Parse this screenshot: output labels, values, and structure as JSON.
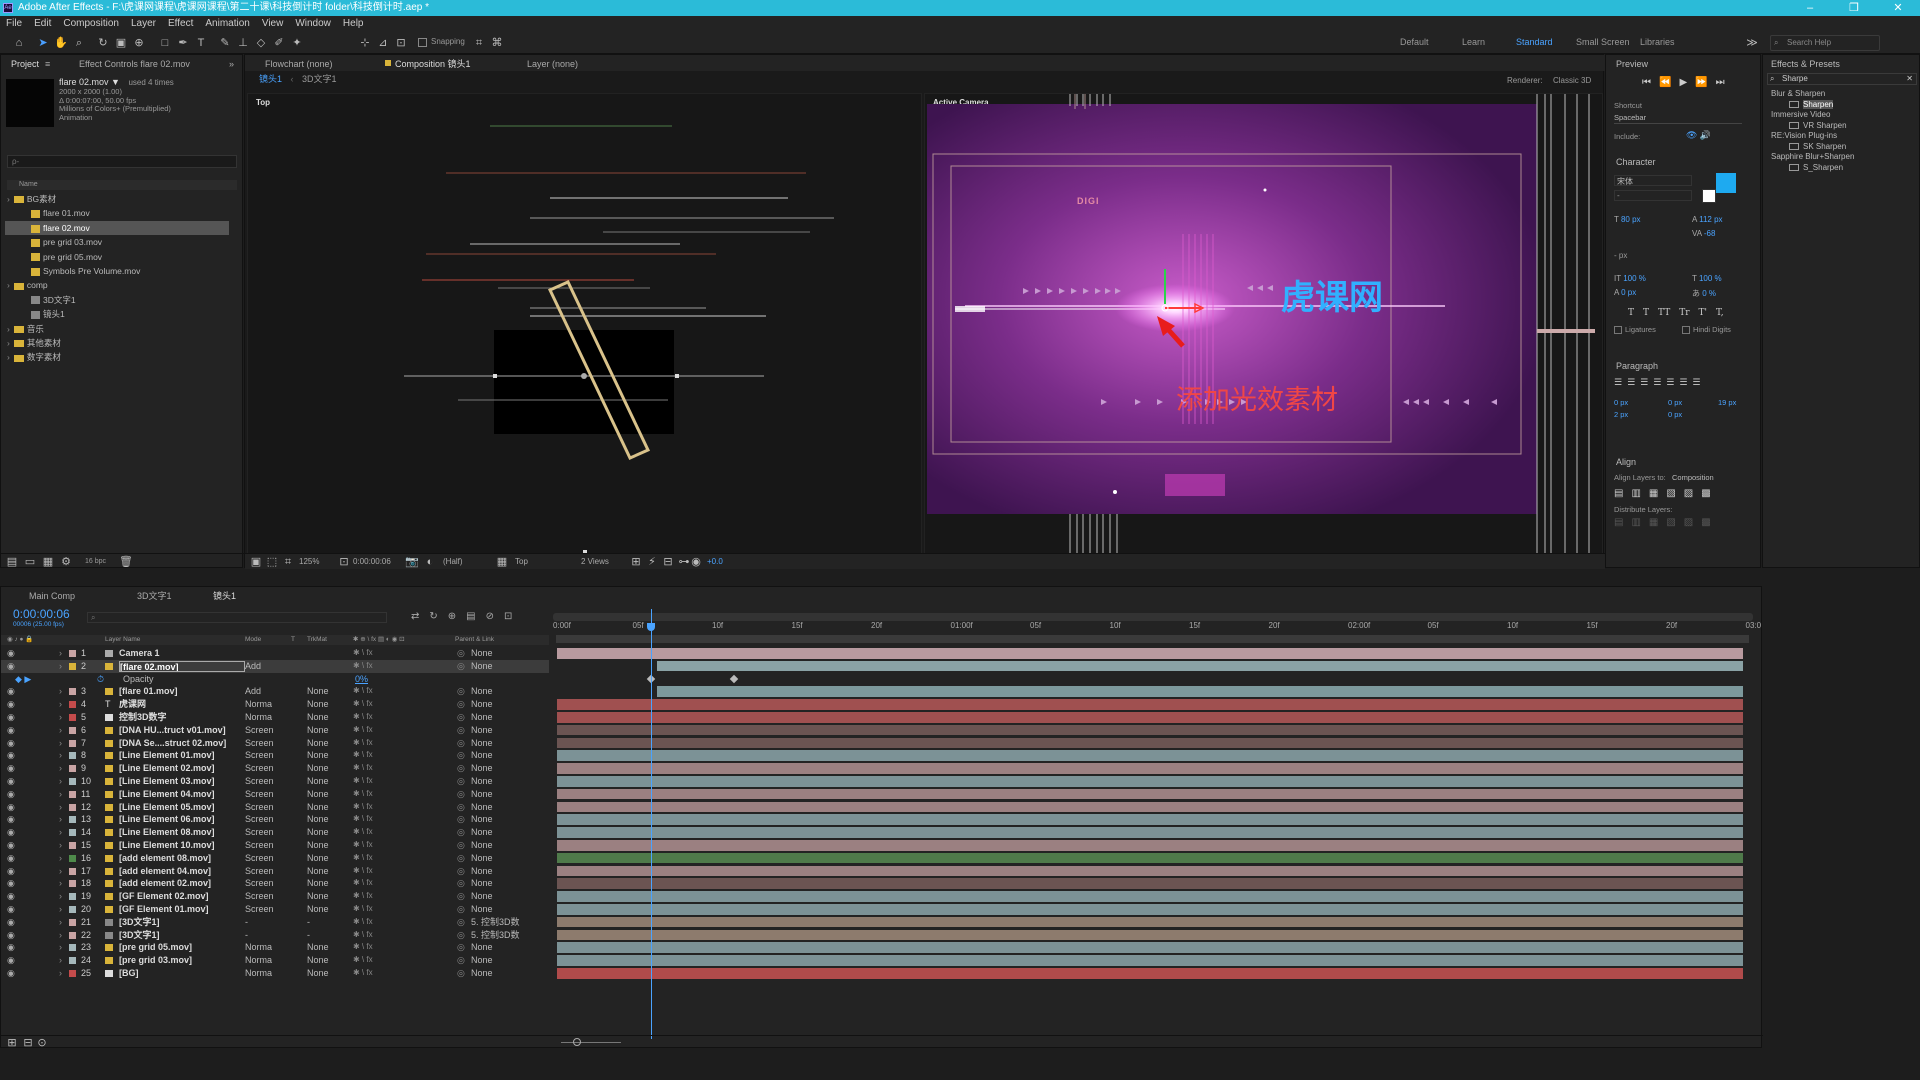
{
  "app": {
    "title": "Adobe After Effects - F:\\虎课网课程\\虎课网课程\\第二十课\\科技倒计时 folder\\科技倒计时.aep *",
    "menus": [
      "File",
      "Edit",
      "Composition",
      "Layer",
      "Effect",
      "Animation",
      "View",
      "Window",
      "Help"
    ]
  },
  "toolbar": {
    "snapping": "Snapping",
    "workspaces": [
      "Default",
      "Learn",
      "Standard",
      "Small Screen",
      "Libraries"
    ],
    "search": "Search Help"
  },
  "project": {
    "tab": "Project",
    "effect_tab": "Effect Controls flare 02.mov",
    "item_name": "flare 02.mov ▼",
    "used": "used 4 times",
    "info": [
      "2000 x 2000 (1.00)",
      "Δ 0:00:07:00, 50.00 fps",
      "Millions of Colors+ (Premultiplied)",
      "Animation"
    ],
    "search_placeholder": "ρ-",
    "col_name": "Name",
    "bpc": "16 bpc",
    "tree": [
      {
        "t": "BG素材",
        "lvl": 0,
        "kind": "folder"
      },
      {
        "t": "flare 01.mov",
        "lvl": 1,
        "kind": "file"
      },
      {
        "t": "flare 02.mov",
        "lvl": 1,
        "kind": "file",
        "sel": true
      },
      {
        "t": "pre grid 03.mov",
        "lvl": 1,
        "kind": "file"
      },
      {
        "t": "pre grid 05.mov",
        "lvl": 1,
        "kind": "file"
      },
      {
        "t": "Symbols Pre Volume.mov",
        "lvl": 1,
        "kind": "file"
      },
      {
        "t": "comp",
        "lvl": 0,
        "kind": "folder"
      },
      {
        "t": "3D文字1",
        "lvl": 1,
        "kind": "comp"
      },
      {
        "t": "镜头1",
        "lvl": 1,
        "kind": "comp"
      },
      {
        "t": "音乐",
        "lvl": 0,
        "kind": "folder"
      },
      {
        "t": "其他素材",
        "lvl": 0,
        "kind": "folder"
      },
      {
        "t": "数字素材",
        "lvl": 0,
        "kind": "folder"
      }
    ]
  },
  "viewer": {
    "tabs": [
      "Flowchart (none)",
      "Composition 镜头1",
      "Layer (none)"
    ],
    "breadcrumbs": [
      "镜头1",
      "3D文字1"
    ],
    "renderer_label": "Renderer:",
    "renderer": "Classic 3D",
    "top_label": "Top",
    "camera_label": "Active Camera",
    "logo_text": "虎课网",
    "annotation": "添加光效素材",
    "digi": "DIGI",
    "zoom": "125%",
    "time": "0:00:00:06",
    "res": "(Half)",
    "view": "Top",
    "views": "2 Views",
    "exposure": "+0.0"
  },
  "preview": {
    "title": "Preview",
    "shortcut_label": "Shortcut",
    "shortcut": "Spacebar",
    "include": "Include:"
  },
  "character": {
    "title": "Character",
    "font": "宋体",
    "size": "80 px",
    "leading": "112 px",
    "tracking": "-68",
    "vscale": "100 %",
    "hscale": "100 %",
    "baseline": "0 px",
    "tsume": "0 %",
    "unit": "- px",
    "ligatures": "Ligatures",
    "hindi": "Hindi Digits",
    "styles": [
      "T",
      "T",
      "TT",
      "Tr",
      "T'",
      "T,"
    ]
  },
  "paragraph": {
    "title": "Paragraph",
    "v1": "0 px",
    "v2": "0 px",
    "v3": "19 px",
    "v4": "2 px",
    "v5": "0 px"
  },
  "align": {
    "title": "Align",
    "align_to_label": "Align Layers to:",
    "align_to": "Composition",
    "distribute": "Distribute Layers:"
  },
  "effects": {
    "title": "Effects & Presets",
    "search": "Sharpe",
    "groups": [
      {
        "name": "Blur & Sharpen",
        "items": [
          "Sharpen"
        ]
      },
      {
        "name": "Immersive Video",
        "items": [
          "VR Sharpen"
        ]
      },
      {
        "name": "RE:Vision Plug-ins",
        "items": [
          "SK Sharpen"
        ]
      },
      {
        "name": "Sapphire Blur+Sharpen",
        "items": [
          "S_Sharpen"
        ]
      }
    ]
  },
  "timeline": {
    "tabs": [
      "Main Comp",
      "3D文字1",
      "镜头1"
    ],
    "timecode": "0:00:00:06",
    "fps": "00006 (25.00 fps)",
    "col_name": "Layer Name",
    "col_mode": "Mode",
    "col_t": "T",
    "col_trk": "TrkMat",
    "col_parent": "Parent & Link",
    "ruler": [
      "0:00f",
      "05f",
      "10f",
      "15f",
      "20f",
      "01:00f",
      "05f",
      "10f",
      "15f",
      "20f",
      "02:00f",
      "05f",
      "10f",
      "15f",
      "20f",
      "03:0"
    ],
    "opacity_label": "Opacity",
    "opacity_value": "0%",
    "layers": [
      {
        "n": "1",
        "name": "Camera 1",
        "mode": "",
        "trk": "",
        "parent": "None",
        "color": "#c9a4a4",
        "bar": "#b89a9f",
        "kind": "cam",
        "start": 0
      },
      {
        "n": "2",
        "name": "[flare 02.mov]",
        "mode": "Add",
        "trk": "",
        "parent": "None",
        "color": "#d9b43a",
        "bar": "#8aa2a5",
        "kind": "file",
        "start": 0.084,
        "sel": true
      },
      {
        "n": "3",
        "name": "[flare 01.mov]",
        "mode": "Add",
        "trk": "None",
        "parent": "None",
        "color": "#c9a4a4",
        "bar": "#7d999c",
        "kind": "file",
        "start": 0.084
      },
      {
        "n": "4",
        "name": "虎课网",
        "mode": "Norma",
        "trk": "None",
        "parent": "None",
        "color": "#c44b4b",
        "bar": "#a05050",
        "kind": "text",
        "start": 0
      },
      {
        "n": "5",
        "name": "控制3D数字",
        "mode": "Norma",
        "trk": "None",
        "parent": "None",
        "color": "#c44b4b",
        "bar": "#a05050",
        "kind": "solid",
        "start": 0
      },
      {
        "n": "6",
        "name": "[DNA HU...truct v01.mov]",
        "mode": "Screen",
        "trk": "None",
        "parent": "None",
        "color": "#c9a4a4",
        "bar": "#6b5452",
        "kind": "file",
        "start": 0
      },
      {
        "n": "7",
        "name": "[DNA Se....struct 02.mov]",
        "mode": "Screen",
        "trk": "None",
        "parent": "None",
        "color": "#c9a4a4",
        "bar": "#6b5452",
        "kind": "file",
        "start": 0
      },
      {
        "n": "8",
        "name": "[Line Element 01.mov]",
        "mode": "Screen",
        "trk": "None",
        "parent": "None",
        "color": "#a5b8bb",
        "bar": "#7c9296",
        "kind": "file",
        "start": 0
      },
      {
        "n": "9",
        "name": "[Line Element 02.mov]",
        "mode": "Screen",
        "trk": "None",
        "parent": "None",
        "color": "#c9a4a4",
        "bar": "#9b8081",
        "kind": "file",
        "start": 0
      },
      {
        "n": "10",
        "name": "[Line Element 03.mov]",
        "mode": "Screen",
        "trk": "None",
        "parent": "None",
        "color": "#a5b8bb",
        "bar": "#7c9296",
        "kind": "file",
        "start": 0
      },
      {
        "n": "11",
        "name": "[Line Element 04.mov]",
        "mode": "Screen",
        "trk": "None",
        "parent": "None",
        "color": "#c9a4a4",
        "bar": "#9b8081",
        "kind": "file",
        "start": 0
      },
      {
        "n": "12",
        "name": "[Line Element 05.mov]",
        "mode": "Screen",
        "trk": "None",
        "parent": "None",
        "color": "#c9a4a4",
        "bar": "#9b8081",
        "kind": "file",
        "start": 0
      },
      {
        "n": "13",
        "name": "[Line Element 06.mov]",
        "mode": "Screen",
        "trk": "None",
        "parent": "None",
        "color": "#a5b8bb",
        "bar": "#7c9296",
        "kind": "file",
        "start": 0
      },
      {
        "n": "14",
        "name": "[Line Element 08.mov]",
        "mode": "Screen",
        "trk": "None",
        "parent": "None",
        "color": "#a5b8bb",
        "bar": "#7c9296",
        "kind": "file",
        "start": 0
      },
      {
        "n": "15",
        "name": "[Line Element 10.mov]",
        "mode": "Screen",
        "trk": "None",
        "parent": "None",
        "color": "#c9a4a4",
        "bar": "#9b8081",
        "kind": "file",
        "start": 0
      },
      {
        "n": "16",
        "name": "[add element 08.mov]",
        "mode": "Screen",
        "trk": "None",
        "parent": "None",
        "color": "#4e8a4a",
        "bar": "#4f7a4a",
        "kind": "file",
        "start": 0
      },
      {
        "n": "17",
        "name": "[add element 04.mov]",
        "mode": "Screen",
        "trk": "None",
        "parent": "None",
        "color": "#c9a4a4",
        "bar": "#9b8081",
        "kind": "file",
        "start": 0
      },
      {
        "n": "18",
        "name": "[add element 02.mov]",
        "mode": "Screen",
        "trk": "None",
        "parent": "None",
        "color": "#c9a4a4",
        "bar": "#6b5452",
        "kind": "file",
        "start": 0
      },
      {
        "n": "19",
        "name": "[GF Element 02.mov]",
        "mode": "Screen",
        "trk": "None",
        "parent": "None",
        "color": "#a5b8bb",
        "bar": "#7c9296",
        "kind": "file",
        "start": 0
      },
      {
        "n": "20",
        "name": "[GF Element 01.mov]",
        "mode": "Screen",
        "trk": "None",
        "parent": "None",
        "color": "#a5b8bb",
        "bar": "#7c9296",
        "kind": "file",
        "start": 0
      },
      {
        "n": "21",
        "name": "[3D文字1]",
        "mode": "-",
        "trk": "-",
        "parent": "5. 控制3D数",
        "color": "#c9a4a4",
        "bar": "#8d7b6d",
        "kind": "comp",
        "start": 0
      },
      {
        "n": "22",
        "name": "[3D文字1]",
        "mode": "-",
        "trk": "-",
        "parent": "5. 控制3D数",
        "color": "#c9a4a4",
        "bar": "#8d7b6d",
        "kind": "comp",
        "start": 0
      },
      {
        "n": "23",
        "name": "[pre grid 05.mov]",
        "mode": "Norma",
        "trk": "None",
        "parent": "None",
        "color": "#a5b8bb",
        "bar": "#7c9296",
        "kind": "file",
        "start": 0
      },
      {
        "n": "24",
        "name": "[pre grid 03.mov]",
        "mode": "Norma",
        "trk": "None",
        "parent": "None",
        "color": "#a5b8bb",
        "bar": "#7c9296",
        "kind": "file",
        "start": 0
      },
      {
        "n": "25",
        "name": "[BG]",
        "mode": "Norma",
        "trk": "None",
        "parent": "None",
        "color": "#c44b4b",
        "bar": "#b04b4b",
        "kind": "solid",
        "start": 0
      }
    ]
  }
}
